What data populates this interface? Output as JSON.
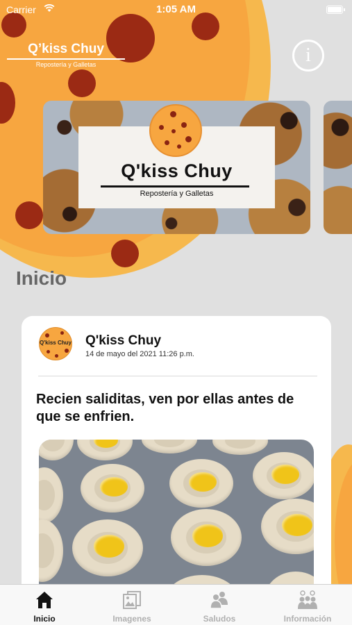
{
  "status_bar": {
    "carrier": "Carrier",
    "time": "1:05 AM"
  },
  "header": {
    "logo_title": "Q’kiss Chuy",
    "logo_subtitle": "Repostería y Galletas",
    "info_icon": "info-circle-icon",
    "info_glyph": "i"
  },
  "banner": {
    "title": "Q'kiss Chuy",
    "subtitle": "Repostería y Galletas"
  },
  "section": {
    "title": "Inicio"
  },
  "post": {
    "avatar_text": "Q'kiss Chuy",
    "author": "Q'kiss Chuy",
    "date": "14 de mayo del 2021 11:26 p.m.",
    "text": "Recien saliditas, ven por ellas antes de que se enfrien."
  },
  "tabs": [
    {
      "label": "Inicio",
      "icon": "home-icon",
      "active": true
    },
    {
      "label": "Imagenes",
      "icon": "photos-icon",
      "active": false
    },
    {
      "label": "Saludos",
      "icon": "people-icon",
      "active": false
    },
    {
      "label": "Información",
      "icon": "group-info-icon",
      "active": false
    }
  ],
  "colors": {
    "accent": "#f7a640",
    "chocolate": "#9b2a14",
    "background": "#e0e0e0"
  }
}
